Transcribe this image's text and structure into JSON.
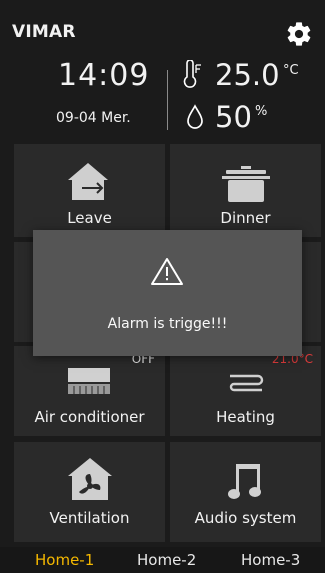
{
  "header": {
    "brand": "VIMAR",
    "time": "14:09",
    "date": "09-04  Mer.",
    "temperature": "25.0",
    "temperature_unit": "°C",
    "humidity": "50",
    "humidity_unit": "%"
  },
  "tiles": [
    {
      "label": "Leave",
      "icon": "house-leave-icon"
    },
    {
      "label": "Dinner",
      "icon": "cooking-pot-icon"
    },
    {
      "label": "Air conditioner",
      "icon": "air-conditioner-icon",
      "status": "OFF"
    },
    {
      "label": "Heating",
      "icon": "heating-coil-icon",
      "status": "21.0°C"
    },
    {
      "label": "Ventilation",
      "icon": "ventilation-fan-icon"
    },
    {
      "label": "Audio system",
      "icon": "music-note-icon"
    }
  ],
  "alarm": {
    "icon": "warning-icon",
    "message": "Alarm is trigge!!!"
  },
  "tabs": [
    {
      "label": "Home-1",
      "active": true
    },
    {
      "label": "Home-2",
      "active": false
    },
    {
      "label": "Home-3",
      "active": false
    }
  ],
  "colors": {
    "background": "#1b1b1b",
    "tile": "#2a2a2a",
    "active_tab": "#f5b800",
    "heating_status": "#e03c3c",
    "alarm_dialog": "#555555"
  }
}
